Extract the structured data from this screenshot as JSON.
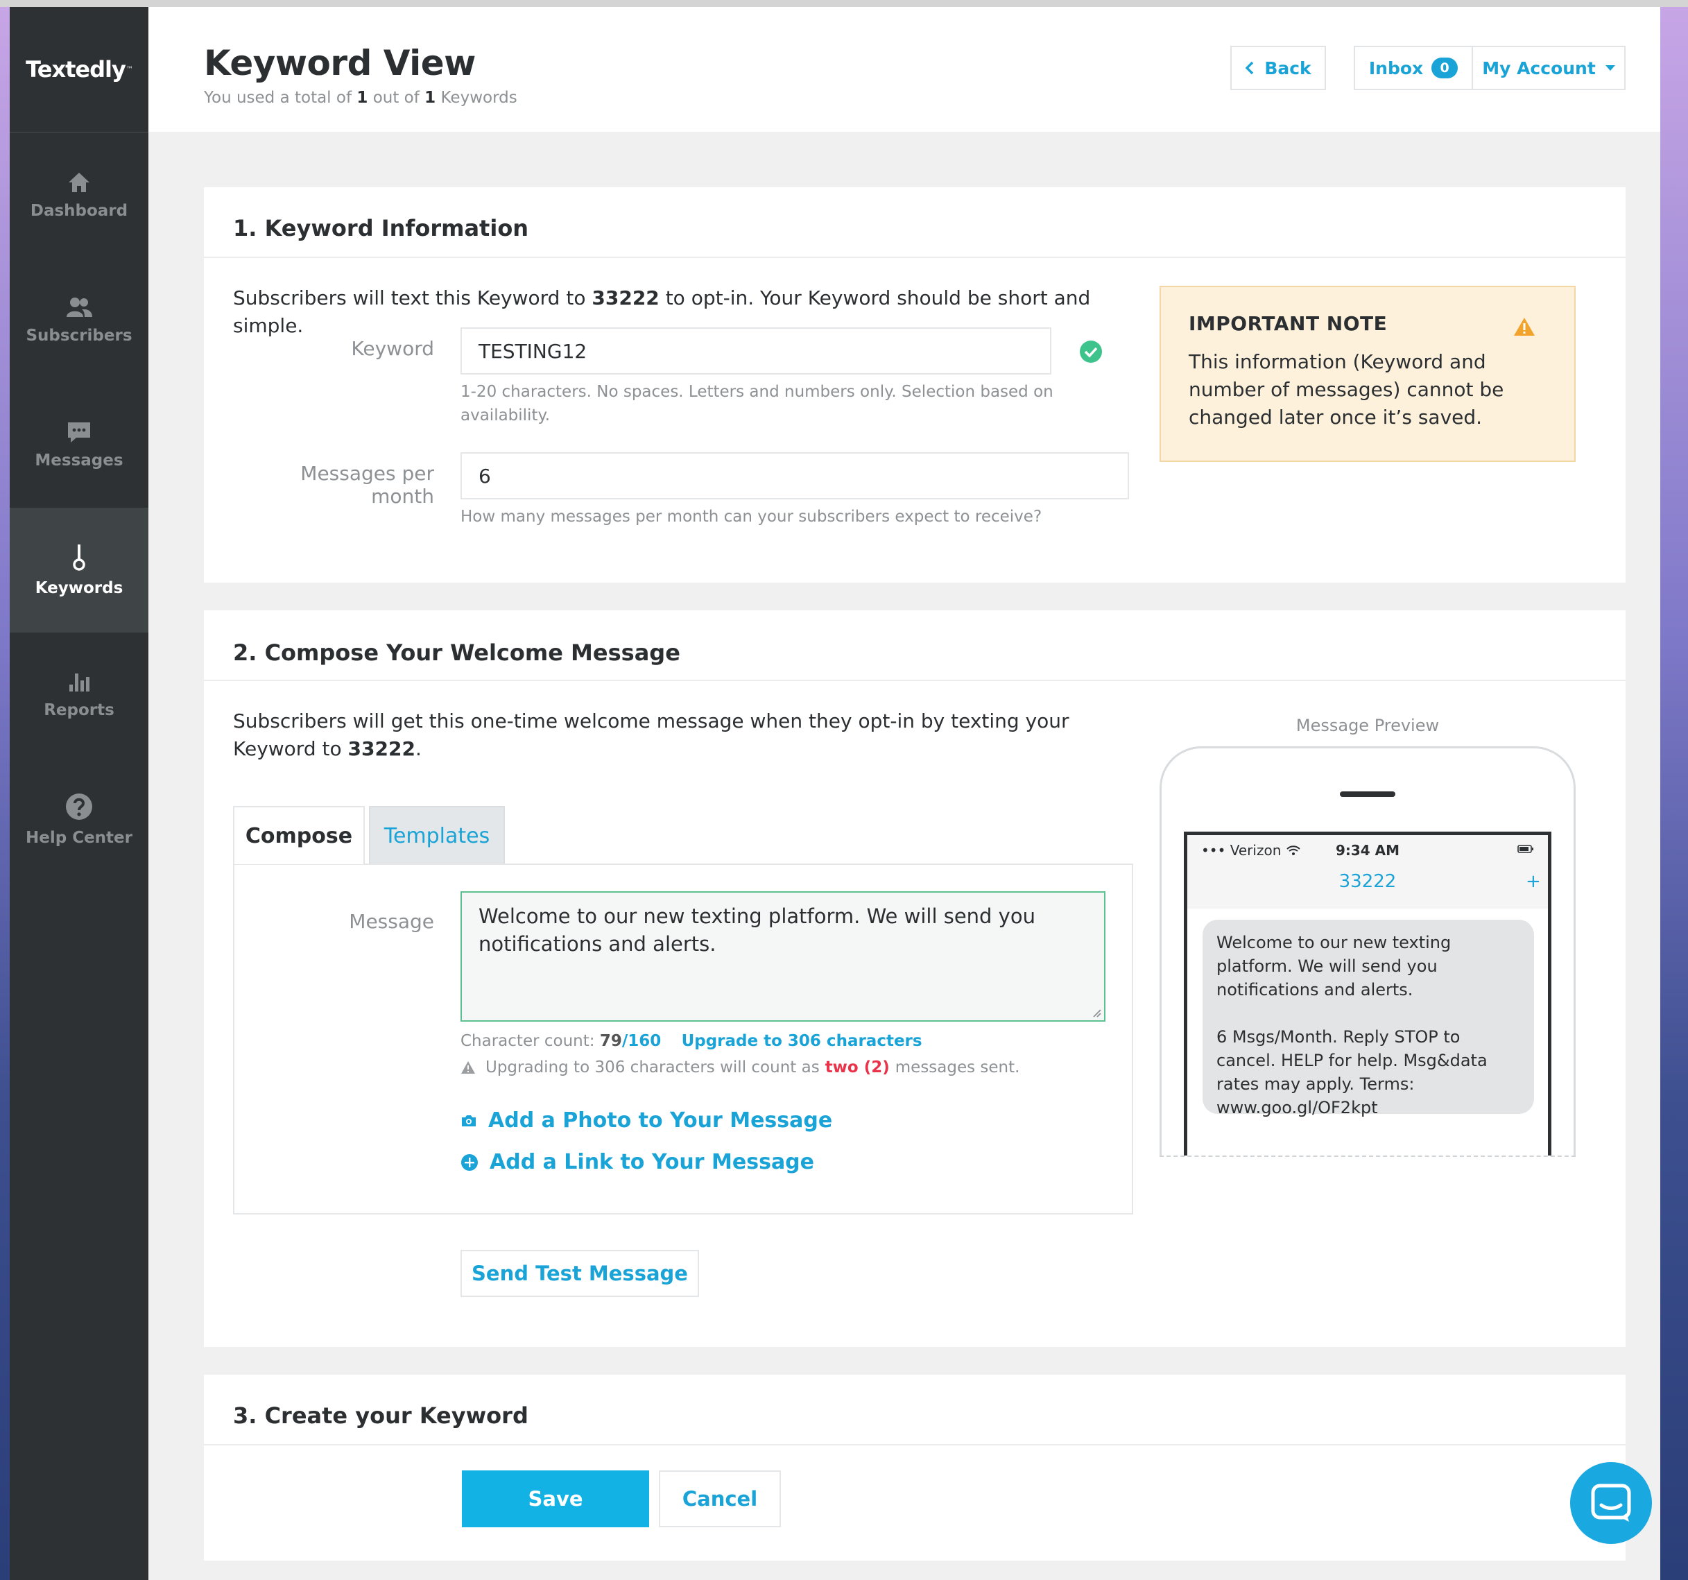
{
  "brand": {
    "name": "Textedly",
    "mark": "™"
  },
  "sidebar": {
    "items": [
      {
        "label": "Dashboard",
        "icon": "home-icon"
      },
      {
        "label": "Subscribers",
        "icon": "users-icon"
      },
      {
        "label": "Messages",
        "icon": "chat-icon"
      },
      {
        "label": "Keywords",
        "icon": "keyword-icon",
        "active": true
      },
      {
        "label": "Reports",
        "icon": "bar-chart-icon"
      },
      {
        "label": "Help Center",
        "icon": "help-icon"
      }
    ]
  },
  "header": {
    "title": "Keyword View",
    "sub_prefix": "You used a total of",
    "sub_used": "1",
    "sub_mid": "out of",
    "sub_total": "1",
    "sub_suffix": "Keywords",
    "back_label": "Back",
    "inbox_label": "Inbox",
    "inbox_count": "0",
    "account_label": "My Account"
  },
  "section1": {
    "title": "1. Keyword Information",
    "intro_a": "Subscribers will text this Keyword to",
    "intro_number": "33222",
    "intro_b": "to opt-in. Your Keyword should be short and simple.",
    "keyword_label": "Keyword",
    "keyword_value": "TESTING12",
    "keyword_hint": "1-20 characters. No spaces. Letters and numbers only. Selection based on availability.",
    "mpm_label": "Messages per month",
    "mpm_value": "6",
    "mpm_hint": "How many messages per month can your subscribers expect to receive?",
    "note_title": "IMPORTANT NOTE",
    "note_text": "This information (Keyword and number of messages) cannot be changed later once it’s saved."
  },
  "section2": {
    "title": "2. Compose Your Welcome Message",
    "intro_a": "Subscribers will get this one-time welcome message when they opt-in by texting your Keyword to",
    "intro_number": "33222",
    "intro_end": ".",
    "tabs": [
      {
        "label": "Compose"
      },
      {
        "label": "Templates"
      }
    ],
    "message_label": "Message",
    "message_value": "Welcome to our new texting platform. We will send you notifications and alerts.",
    "char_prefix": "Character count:",
    "char_used": "79",
    "char_sep": "/",
    "char_max": "160",
    "upgrade_label": "Upgrade to 306 characters",
    "warn_a": "Upgrading to 306 characters will count as",
    "warn_count": "two (2)",
    "warn_b": "messages sent.",
    "add_photo": "Add a Photo to Your Message",
    "add_link": "Add a Link to Your Message",
    "send_test": "Send Test Message",
    "preview_label": "Message Preview",
    "phone": {
      "carrier": "••• Verizon",
      "time": "9:34 AM",
      "contact": "33222",
      "plus": "+",
      "bubble_line1": "Welcome to our new texting platform. We will send you notifications and alerts.",
      "bubble_line2": "6 Msgs/Month. Reply STOP to cancel. HELP for help. Msg&data rates may apply. Terms: www.goo.gl/OF2kpt"
    }
  },
  "section3": {
    "title": "3. Create your Keyword",
    "save_label": "Save",
    "cancel_label": "Cancel"
  },
  "colors": {
    "accent": "#1aa3d6",
    "sidebar": "#2e3133",
    "success": "#3fc38c",
    "warning": "#f1a32b",
    "danger": "#e8334a"
  }
}
